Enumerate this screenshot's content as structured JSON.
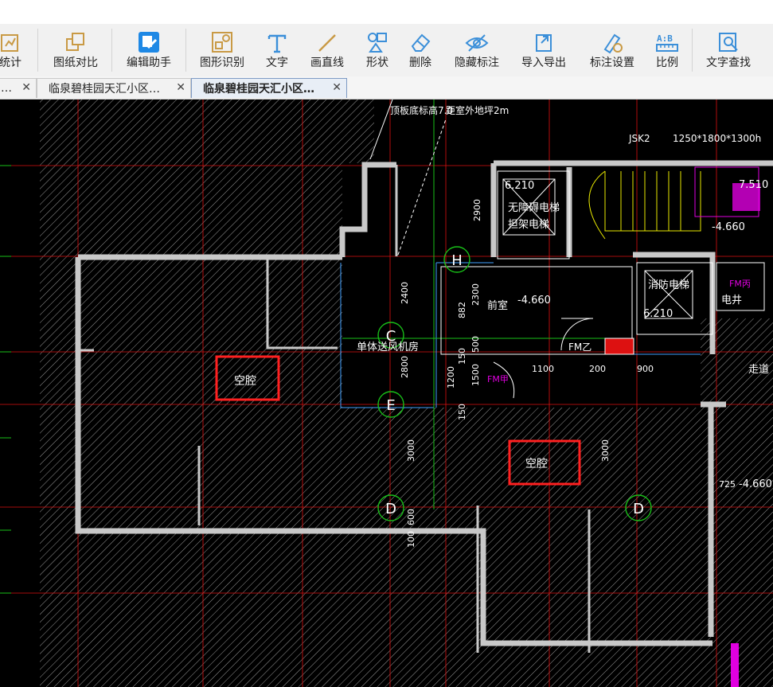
{
  "toolbar": {
    "items": [
      {
        "label": "统计",
        "icon": "statistics-icon"
      },
      {
        "label": "图纸对比",
        "icon": "compare-icon"
      },
      {
        "label": "编辑助手",
        "icon": "edit-assistant-icon"
      },
      {
        "label": "图形识别",
        "icon": "shape-recognition-icon"
      },
      {
        "label": "文字",
        "icon": "text-icon"
      },
      {
        "label": "画直线",
        "icon": "line-icon"
      },
      {
        "label": "形状",
        "icon": "shapes-icon"
      },
      {
        "label": "删除",
        "icon": "eraser-icon"
      },
      {
        "label": "隐藏标注",
        "icon": "hide-eye-icon"
      },
      {
        "label": "导入导出",
        "icon": "import-export-icon"
      },
      {
        "label": "标注设置",
        "icon": "annotation-settings-icon"
      },
      {
        "label": "比例",
        "icon": "scale-icon"
      },
      {
        "label": "文字查找",
        "icon": "text-search-icon"
      }
    ]
  },
  "tabs": [
    {
      "label": "…",
      "active": false
    },
    {
      "label": "临泉碧桂园天汇小区…",
      "active": false
    },
    {
      "label": "临泉碧桂园天汇小区…",
      "active": true
    }
  ],
  "drawing": {
    "labels": {
      "void1": "空腔",
      "void2": "空腔",
      "elevator_accessible": "无障碍电梯",
      "elevator_stretcher": "担架电梯",
      "fire_elevator": "消防电梯",
      "elec_shaft": "电井",
      "fan_room": "单体送风机房",
      "anteroom": "前室",
      "corridor": "走道",
      "fm_b": "FM乙",
      "fm_c": "FM丙",
      "fm_d": "FM甲"
    },
    "levels": {
      "lv1": "6.210",
      "lv2": "-4.660",
      "lv3": "6.210",
      "lv4": "-4.660",
      "lv5": "-4.660",
      "lv6": "7.510",
      "lv7": "-4.660"
    },
    "dims": {
      "d2400": "2400",
      "d2800": "2800",
      "d2300": "2300",
      "d882": "882",
      "d500": "500",
      "d150a": "150",
      "d1200": "1200",
      "d1500": "1500",
      "d150b": "150",
      "d1100": "1100",
      "d200": "200",
      "d900": "900",
      "d3000a": "3000",
      "d3000b": "3000",
      "d725": "725",
      "d600": "600",
      "d100": "100",
      "d2900": "2900"
    },
    "notes": {
      "jsk": "JSK2",
      "jsk_size": "1250*1800*1300h",
      "top_note1": "顶板底标高7.0",
      "top_note2": "距室外地坪2m"
    },
    "axes": {
      "h": "H",
      "c": "C",
      "e": "E",
      "d1": "D",
      "d2": "D"
    }
  }
}
